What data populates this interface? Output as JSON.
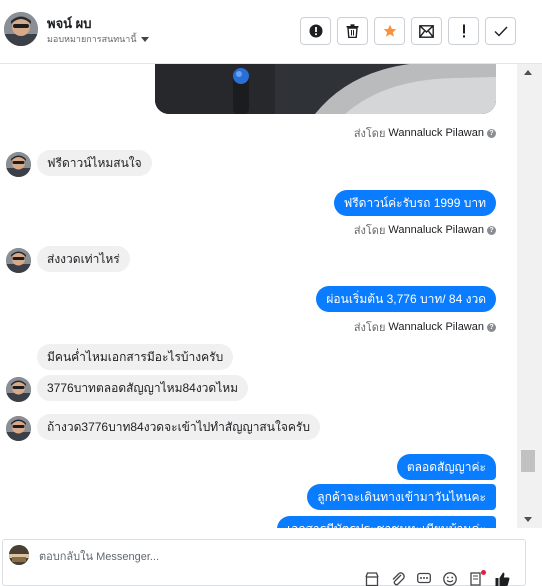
{
  "header": {
    "contact_name": "พจน์ ผบ",
    "subtitle": "มอบหมายการสนทนานี้",
    "toolbar": [
      {
        "name": "flag-spam-button",
        "icon": "alert-circle-icon"
      },
      {
        "name": "delete-button",
        "icon": "trash-icon"
      },
      {
        "name": "star-button",
        "icon": "star-icon"
      },
      {
        "name": "mark-unread-button",
        "icon": "envelope-icon"
      },
      {
        "name": "follow-up-button",
        "icon": "exclamation-icon"
      },
      {
        "name": "mark-done-button",
        "icon": "checkmark-icon"
      }
    ]
  },
  "sent_by_label": "ส่งโดย",
  "help_glyph": "?",
  "messages": {
    "sent_1_by": "Wannaluck Pilawan",
    "in_1": "ฟรีดาวน์ไหมสนใจ",
    "out_1": "ฟรีดาวน์ค่ะรับรถ  1999  บาท",
    "sent_2_by": "Wannaluck Pilawan",
    "in_2": "ส่งงวดเท่าไหร่",
    "out_2": "ผ่อนเริ่มต้น  3,776 บาท/ 84 งวด",
    "sent_3_by": "Wannaluck Pilawan",
    "in_3": "มีคนค่ำไหมเอกสารมีอะไรบ้างครับ",
    "in_4": "3776บาทตลอดสัญญาไหม84งวดไหม",
    "in_5": "ถ้างวด3776บาท84งวดจะเข้าไปทำสัญญาสนใจครับ",
    "out_3": "ตลอดสัญญาค่ะ",
    "out_4": "ลูกค้าจะเดินทางเข้ามาวันไหนคะ",
    "out_5": "เอกสารมีบัตรประชาชนทะเบียนบ้านค่ะ"
  },
  "composer": {
    "placeholder": "ตอบกลับใน Messenger..."
  },
  "colors": {
    "outgoing_bubble": "#0a7cff",
    "incoming_bubble": "#f0f0f0",
    "star": "#f7923a"
  }
}
